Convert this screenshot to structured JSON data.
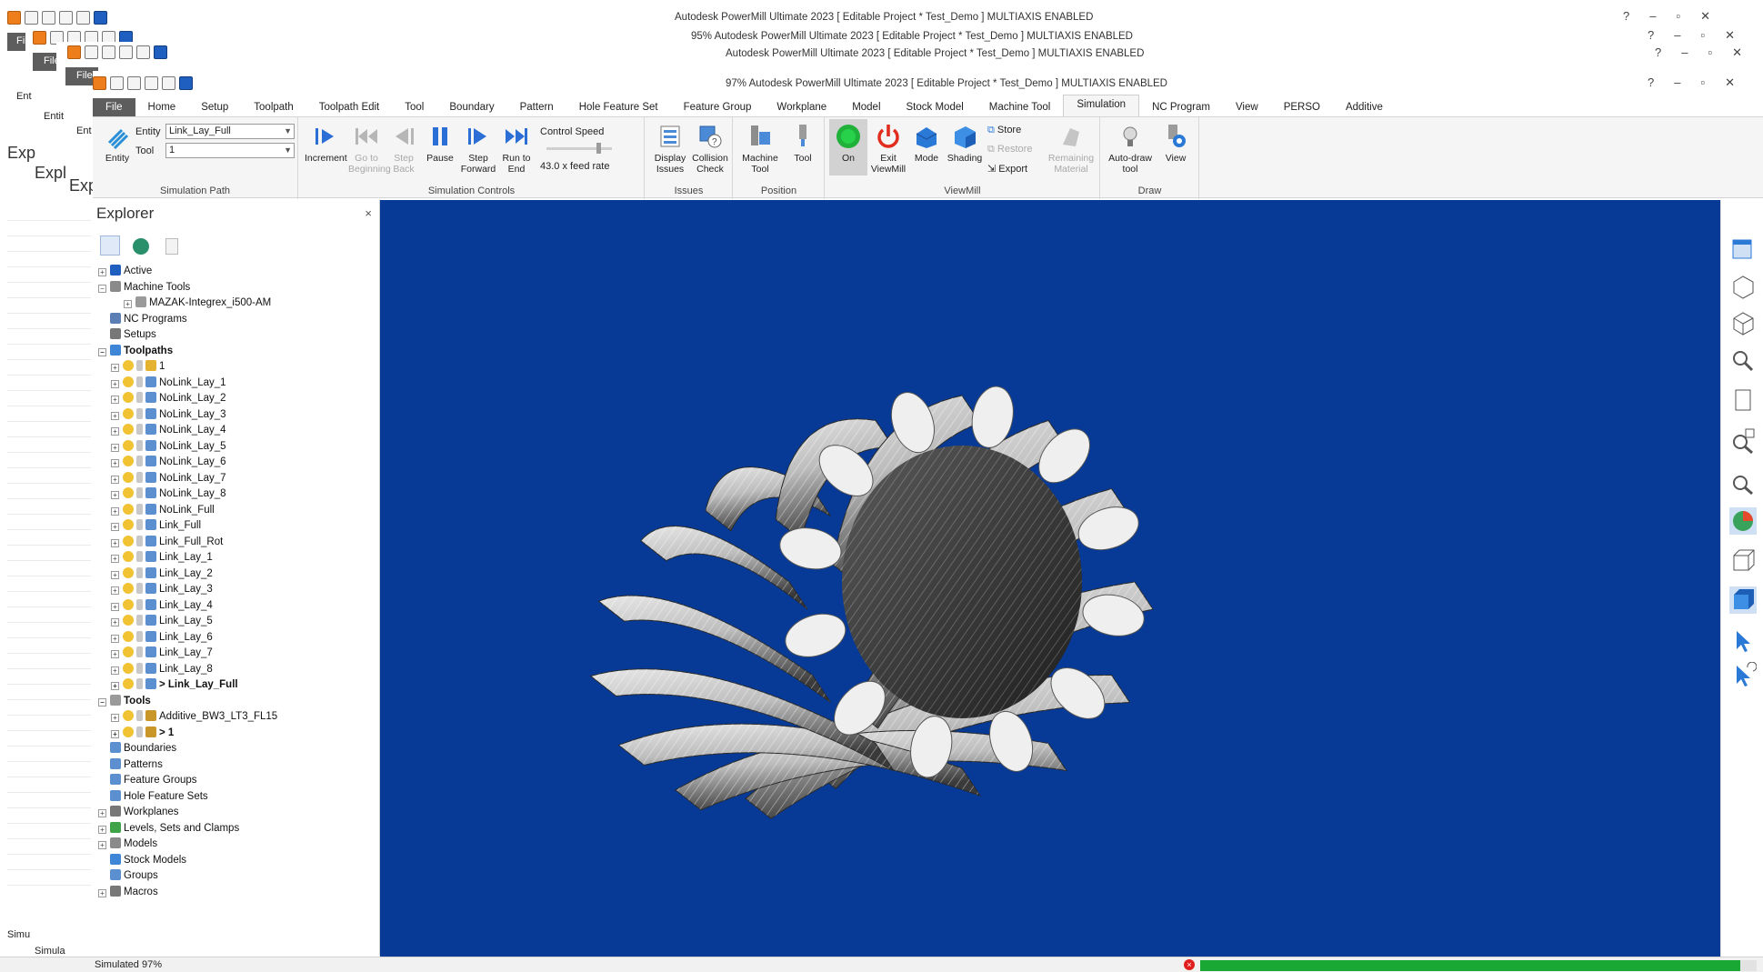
{
  "titles": {
    "back_title": "Autodesk PowerMill Ultimate 2023    [ Editable Project * Test_Demo ]    MULTIAXIS ENABLED",
    "mid_title": "95% Autodesk PowerMill Ultimate 2023    [ Editable Project * Test_Demo ]    MULTIAXIS ENABLED",
    "third_title": "Autodesk PowerMill Ultimate 2023    [ Editable Project * Test_Demo ]    MULTIAXIS ENABLED",
    "main_title": "97% Autodesk PowerMill Ultimate 2023    [ Editable Project * Test_Demo ]    MULTIAXIS ENABLED"
  },
  "ghost": {
    "file": "File",
    "ent_a": "Ent",
    "ent_b": "Entit",
    "ent_c": "Ent",
    "exp_a": "Exp",
    "exp_b": "Expl",
    "exp_c": "Exp",
    "simu_a": "Simu",
    "simu_b": "Simula"
  },
  "tabs": [
    "File",
    "Home",
    "Setup",
    "Toolpath",
    "Toolpath Edit",
    "Tool",
    "Boundary",
    "Pattern",
    "Hole Feature Set",
    "Feature Group",
    "Workplane",
    "Model",
    "Stock Model",
    "Machine Tool",
    "Simulation",
    "NC Program",
    "View",
    "PERSO",
    "Additive"
  ],
  "ribbon": {
    "entity_btn": "Entity",
    "entity_label": "Entity",
    "entity_value": "Link_Lay_Full",
    "tool_label": "Tool",
    "tool_value": "1",
    "sim_path_label": "Simulation Path",
    "increment": "Increment",
    "go_begin": "Go to Beginning",
    "step_back": "Step Back",
    "pause": "Pause",
    "step_forward": "Step Forward",
    "run_to_end": "Run to End",
    "control_speed": "Control Speed",
    "feed_rate": "43.0 x feed rate",
    "sim_controls_label": "Simulation Controls",
    "display_issues": "Display Issues",
    "collision_check": "Collision Check",
    "issues_label": "Issues",
    "machine_tool": "Machine Tool",
    "tool": "Tool",
    "position_label": "Position",
    "on": "On",
    "exit_viewmill": "Exit ViewMill",
    "mode": "Mode",
    "shading": "Shading",
    "store": "Store",
    "restore": "Restore",
    "export": "Export",
    "remaining_material": "Remaining Material",
    "viewmill_label": "ViewMill",
    "auto_draw": "Auto-draw tool",
    "view": "View",
    "draw_label": "Draw"
  },
  "explorer": {
    "title": "Explorer",
    "close": "×",
    "tree": [
      {
        "label": "Active",
        "indent": 0,
        "exp": "+",
        "icon": "#1e5fbf",
        "bold": false
      },
      {
        "label": "Machine Tools",
        "indent": 0,
        "exp": "−",
        "icon": "#8a8a8a",
        "bold": false
      },
      {
        "label": "MAZAK-Integrex_i500-AM",
        "indent": 2,
        "exp": "+",
        "icon": "#9a9a9a",
        "bold": false
      },
      {
        "label": "NC Programs",
        "indent": 0,
        "exp": "",
        "icon": "#5b7fb5",
        "bold": false
      },
      {
        "label": "Setups",
        "indent": 0,
        "exp": "",
        "icon": "#777777",
        "bold": false
      },
      {
        "label": "Toolpaths",
        "indent": 0,
        "exp": "−",
        "icon": "#3f86d6",
        "bold": true
      },
      {
        "label": "1",
        "indent": 1,
        "exp": "+",
        "icon": "#e4b22e",
        "bold": false
      },
      {
        "label": "NoLink_Lay_1",
        "indent": 1,
        "exp": "+",
        "icon": "#5b8fd0",
        "bold": false
      },
      {
        "label": "NoLink_Lay_2",
        "indent": 1,
        "exp": "+",
        "icon": "#5b8fd0",
        "bold": false
      },
      {
        "label": "NoLink_Lay_3",
        "indent": 1,
        "exp": "+",
        "icon": "#5b8fd0",
        "bold": false
      },
      {
        "label": "NoLink_Lay_4",
        "indent": 1,
        "exp": "+",
        "icon": "#5b8fd0",
        "bold": false
      },
      {
        "label": "NoLink_Lay_5",
        "indent": 1,
        "exp": "+",
        "icon": "#5b8fd0",
        "bold": false
      },
      {
        "label": "NoLink_Lay_6",
        "indent": 1,
        "exp": "+",
        "icon": "#5b8fd0",
        "bold": false
      },
      {
        "label": "NoLink_Lay_7",
        "indent": 1,
        "exp": "+",
        "icon": "#5b8fd0",
        "bold": false
      },
      {
        "label": "NoLink_Lay_8",
        "indent": 1,
        "exp": "+",
        "icon": "#5b8fd0",
        "bold": false
      },
      {
        "label": "NoLink_Full",
        "indent": 1,
        "exp": "+",
        "icon": "#5b8fd0",
        "bold": false
      },
      {
        "label": "Link_Full",
        "indent": 1,
        "exp": "+",
        "icon": "#5b8fd0",
        "bold": false
      },
      {
        "label": "Link_Full_Rot",
        "indent": 1,
        "exp": "+",
        "icon": "#5b8fd0",
        "bold": false
      },
      {
        "label": "Link_Lay_1",
        "indent": 1,
        "exp": "+",
        "icon": "#5b8fd0",
        "bold": false
      },
      {
        "label": "Link_Lay_2",
        "indent": 1,
        "exp": "+",
        "icon": "#5b8fd0",
        "bold": false
      },
      {
        "label": "Link_Lay_3",
        "indent": 1,
        "exp": "+",
        "icon": "#5b8fd0",
        "bold": false
      },
      {
        "label": "Link_Lay_4",
        "indent": 1,
        "exp": "+",
        "icon": "#5b8fd0",
        "bold": false
      },
      {
        "label": "Link_Lay_5",
        "indent": 1,
        "exp": "+",
        "icon": "#5b8fd0",
        "bold": false
      },
      {
        "label": "Link_Lay_6",
        "indent": 1,
        "exp": "+",
        "icon": "#5b8fd0",
        "bold": false
      },
      {
        "label": "Link_Lay_7",
        "indent": 1,
        "exp": "+",
        "icon": "#5b8fd0",
        "bold": false
      },
      {
        "label": "Link_Lay_8",
        "indent": 1,
        "exp": "+",
        "icon": "#5b8fd0",
        "bold": false
      },
      {
        "label": "> Link_Lay_Full",
        "indent": 1,
        "exp": "+",
        "icon": "#5b8fd0",
        "bold": true
      },
      {
        "label": "Tools",
        "indent": 0,
        "exp": "−",
        "icon": "#9a9a9a",
        "bold": true
      },
      {
        "label": "Additive_BW3_LT3_FL15",
        "indent": 1,
        "exp": "+",
        "icon": "#c9962a",
        "bold": false
      },
      {
        "label": "> 1",
        "indent": 1,
        "exp": "+",
        "icon": "#c9962a",
        "bold": true
      },
      {
        "label": "Boundaries",
        "indent": 0,
        "exp": "",
        "icon": "#5b8fd0",
        "bold": false
      },
      {
        "label": "Patterns",
        "indent": 0,
        "exp": "",
        "icon": "#5b8fd0",
        "bold": false
      },
      {
        "label": "Feature Groups",
        "indent": 0,
        "exp": "",
        "icon": "#5b8fd0",
        "bold": false
      },
      {
        "label": "Hole Feature Sets",
        "indent": 0,
        "exp": "",
        "icon": "#5b8fd0",
        "bold": false
      },
      {
        "label": "Workplanes",
        "indent": 0,
        "exp": "+",
        "icon": "#777777",
        "bold": false
      },
      {
        "label": "Levels, Sets and Clamps",
        "indent": 0,
        "exp": "+",
        "icon": "#3fa34a",
        "bold": false
      },
      {
        "label": "Models",
        "indent": 0,
        "exp": "+",
        "icon": "#8a8a8a",
        "bold": false
      },
      {
        "label": "Stock Models",
        "indent": 0,
        "exp": "",
        "icon": "#3f86d6",
        "bold": false
      },
      {
        "label": "Groups",
        "indent": 0,
        "exp": "",
        "icon": "#5b8fd0",
        "bold": false
      },
      {
        "label": "Macros",
        "indent": 0,
        "exp": "+",
        "icon": "#777777",
        "bold": false
      }
    ]
  },
  "status": {
    "text": "Simulated 97%",
    "progress": 0.97,
    "progress_color": "#1aa835"
  },
  "colors": {
    "viewport_bg": "#063a96",
    "accent_blue": "#1e5fbf"
  }
}
